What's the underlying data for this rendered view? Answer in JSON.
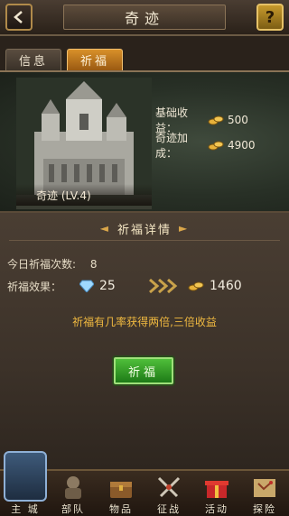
{
  "header": {
    "title": "奇迹"
  },
  "tabs": [
    {
      "label": "信息",
      "active": false
    },
    {
      "label": "祈福",
      "active": true
    }
  ],
  "wonder": {
    "name": "奇迹 (LV.4)",
    "base_income_label": "基础收益：",
    "base_income_value": "500",
    "bonus_label": "奇迹加成：",
    "bonus_value": "4900"
  },
  "details": {
    "title": "祈福详情",
    "daily_count_label": "今日祈福次数:",
    "daily_count_value": "8",
    "effect_label": "祈福效果：",
    "gem_cost": "25",
    "gold_gain": "1460",
    "notice": "祈福有几率获得两倍,三倍收益",
    "button_label": "祈福"
  },
  "nav": [
    {
      "label": "主 城",
      "icon": "castle-icon",
      "active": true
    },
    {
      "label": "部队",
      "icon": "troops-icon"
    },
    {
      "label": "物品",
      "icon": "chest-icon"
    },
    {
      "label": "征战",
      "icon": "swords-icon"
    },
    {
      "label": "活动",
      "icon": "gift-icon"
    },
    {
      "label": "探险",
      "icon": "map-icon"
    }
  ],
  "colors": {
    "accent": "#f0b940",
    "tab_active": "#d8902a",
    "button_green": "#2e9a25",
    "gem": "#9fd9ff",
    "gold": "#e8b23a"
  }
}
